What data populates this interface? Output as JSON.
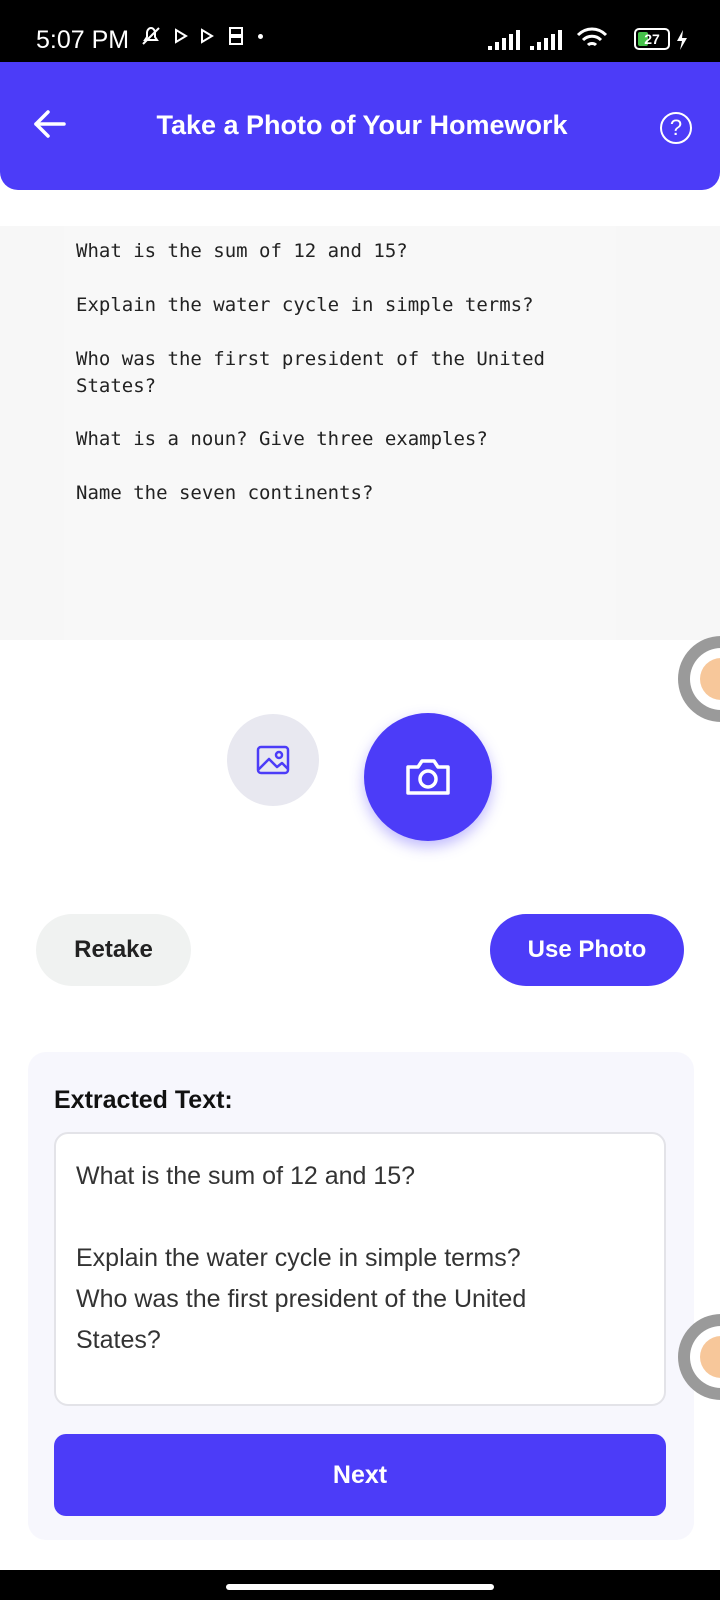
{
  "status_bar": {
    "time": "5:07 PM",
    "battery": "27"
  },
  "header": {
    "title": "Take a Photo of Your Homework",
    "help_icon": "?"
  },
  "preview": {
    "lines": [
      "What is the sum of 12 and 15?",
      "Explain the water cycle in simple terms?",
      "Who was the first president of the United",
      "States?",
      "What is a noun? Give three examples?",
      "Name the seven continents?"
    ]
  },
  "actions": {
    "retake_label": "Retake",
    "use_photo_label": "Use Photo"
  },
  "extracted": {
    "title": "Extracted Text:",
    "text": "What is the sum of 12 and 15?\n\nExplain the water cycle in simple terms?\nWho was the first president of the United\nStates?",
    "next_label": "Next"
  },
  "colors": {
    "accent": "#4c3cf8",
    "header_bg": "#4c3cf8"
  },
  "icons": {
    "back": "arrow-left-icon",
    "help": "question-circle-icon",
    "gallery": "image-icon",
    "camera": "camera-icon"
  }
}
